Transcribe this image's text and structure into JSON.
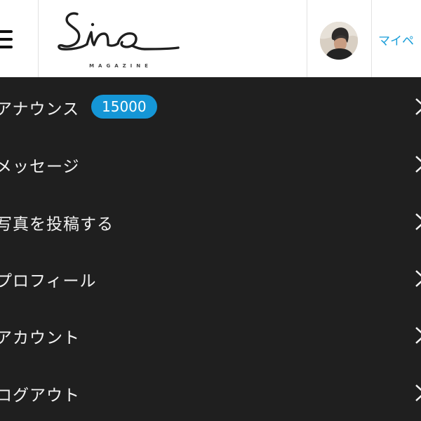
{
  "header": {
    "menu_icon": "hamburger-menu-icon",
    "logo": {
      "wordmark": "Sina",
      "subtitle": "MAGAZINE"
    },
    "avatar_icon": "user-avatar",
    "mypage_label": "マイペ"
  },
  "menu": {
    "items": [
      {
        "label": "アナウンス",
        "badge": "15000",
        "icon": "chevron-right-icon"
      },
      {
        "label": "メッセージ",
        "icon": "chevron-right-icon"
      },
      {
        "label": "写真を投稿する",
        "icon": "chevron-right-icon"
      },
      {
        "label": "プロフィール",
        "icon": "chevron-right-icon"
      },
      {
        "label": "アカウント",
        "icon": "chevron-right-icon"
      },
      {
        "label": "ログアウト",
        "icon": "chevron-right-icon"
      }
    ]
  },
  "colors": {
    "header_bg": "#ffffff",
    "menu_bg": "#1f1f1f",
    "accent": "#1596d6",
    "link": "#1a9ed9",
    "menu_text": "#f2f2f2"
  }
}
